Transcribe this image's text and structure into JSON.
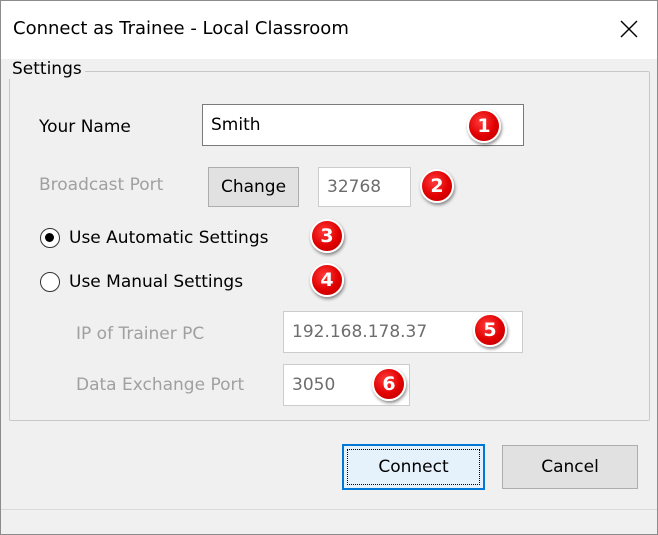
{
  "window": {
    "title": "Connect as Trainee - Local Classroom",
    "close_glyph": "✕"
  },
  "settings_group": {
    "legend": "Settings",
    "your_name_label": "Your Name",
    "your_name_value": "Smith",
    "broadcast_port_label": "Broadcast Port",
    "change_button_label": "Change",
    "broadcast_port_value": "32768",
    "automatic_settings_label": "Use Automatic Settings",
    "automatic_settings_selected": true,
    "manual_settings_label": "Use Manual Settings",
    "manual_settings_selected": false,
    "trainer_ip_label": "IP of Trainer PC",
    "trainer_ip_value": "192.168.178.37",
    "data_port_label": "Data Exchange Port",
    "data_port_value": "3050"
  },
  "badges": [
    "1",
    "2",
    "3",
    "4",
    "5",
    "6"
  ],
  "footer": {
    "connect_label": "Connect",
    "cancel_label": "Cancel"
  },
  "colors": {
    "badge_red": "#e00000",
    "default_button_border": "#0078d7",
    "disabled_text": "#a0a0a0"
  }
}
